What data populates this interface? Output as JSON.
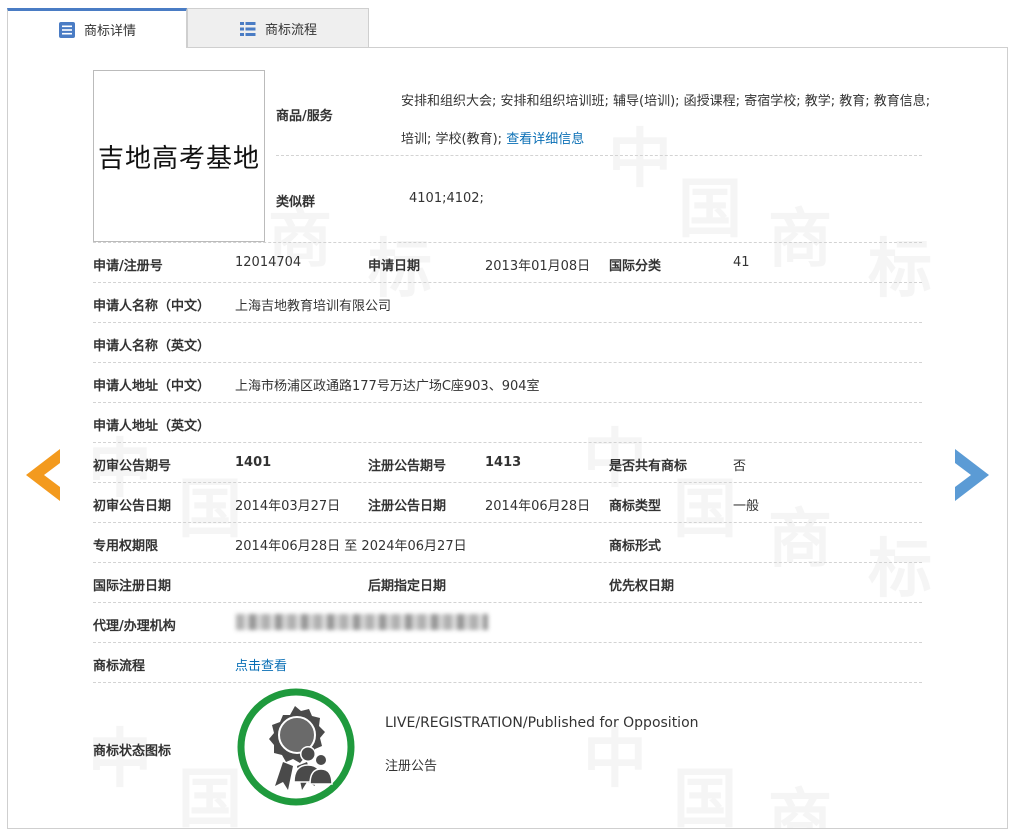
{
  "tabs": {
    "detail": "商标详情",
    "flow": "商标流程"
  },
  "watermark": {
    "chars": [
      "中",
      "国",
      "商",
      "标"
    ]
  },
  "logo": {
    "text": "吉地高考基地"
  },
  "goods": {
    "label": "商品/服务",
    "text": "安排和组织大会; 安排和组织培训班; 辅导(培训); 函授课程; 寄宿学校; 教学; 教育; 教育信息; 培训; 学校(教育);",
    "link": "查看详细信息"
  },
  "similar": {
    "label": "类似群",
    "value": "4101;4102;"
  },
  "reg_no": {
    "label": "申请/注册号",
    "value": "12014704"
  },
  "app_date": {
    "label": "申请日期",
    "value": "2013年01月08日"
  },
  "intl_class": {
    "label": "国际分类",
    "value": "41"
  },
  "applicant_cn": {
    "label": "申请人名称（中文）",
    "value": "上海吉地教育培训有限公司"
  },
  "applicant_en": {
    "label": "申请人名称（英文）",
    "value": ""
  },
  "address_cn": {
    "label": "申请人地址（中文）",
    "value": "上海市杨浦区政通路177号万达广场C座903、904室"
  },
  "address_en": {
    "label": "申请人地址（英文）",
    "value": ""
  },
  "prelim_no": {
    "label": "初审公告期号",
    "value": "1401"
  },
  "reg_notice_no": {
    "label": "注册公告期号",
    "value": "1413"
  },
  "shared": {
    "label": "是否共有商标",
    "value": "否"
  },
  "prelim_date": {
    "label": "初审公告日期",
    "value": "2014年03月27日"
  },
  "reg_notice_date": {
    "label": "注册公告日期",
    "value": "2014年06月28日"
  },
  "tm_type": {
    "label": "商标类型",
    "value": "一般"
  },
  "validity": {
    "label": "专用权期限",
    "value": "2014年06月28日 至 2024年06月27日"
  },
  "tm_form": {
    "label": "商标形式",
    "value": ""
  },
  "intl_reg_date": {
    "label": "国际注册日期",
    "value": ""
  },
  "later_date": {
    "label": "后期指定日期",
    "value": ""
  },
  "priority_date": {
    "label": "优先权日期",
    "value": ""
  },
  "agency": {
    "label": "代理/办理机构"
  },
  "process": {
    "label": "商标流程",
    "link": "点击查看"
  },
  "status": {
    "label": "商标状态图标",
    "en": "LIVE/REGISTRATION/Published for Opposition",
    "cn": "注册公告"
  },
  "colors": {
    "accent": "#4a7cc4",
    "arrow_left": "#f39a1e",
    "arrow_right": "#5b9bd5",
    "status_ring": "#1f9a3d",
    "link": "#0a6fb5"
  },
  "icons": {
    "prev": "chevron-left-icon",
    "next": "chevron-right-icon",
    "detail_tab": "document-list-icon",
    "flow_tab": "list-icon"
  }
}
